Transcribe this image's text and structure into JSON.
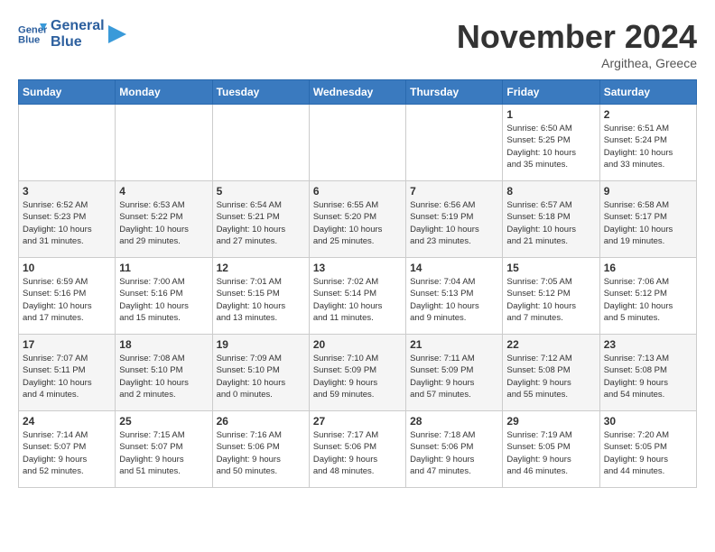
{
  "logo": {
    "line1": "General",
    "line2": "Blue"
  },
  "header": {
    "month": "November 2024",
    "location": "Argithea, Greece"
  },
  "weekdays": [
    "Sunday",
    "Monday",
    "Tuesday",
    "Wednesday",
    "Thursday",
    "Friday",
    "Saturday"
  ],
  "weeks": [
    [
      {
        "day": "",
        "info": ""
      },
      {
        "day": "",
        "info": ""
      },
      {
        "day": "",
        "info": ""
      },
      {
        "day": "",
        "info": ""
      },
      {
        "day": "",
        "info": ""
      },
      {
        "day": "1",
        "info": "Sunrise: 6:50 AM\nSunset: 5:25 PM\nDaylight: 10 hours\nand 35 minutes."
      },
      {
        "day": "2",
        "info": "Sunrise: 6:51 AM\nSunset: 5:24 PM\nDaylight: 10 hours\nand 33 minutes."
      }
    ],
    [
      {
        "day": "3",
        "info": "Sunrise: 6:52 AM\nSunset: 5:23 PM\nDaylight: 10 hours\nand 31 minutes."
      },
      {
        "day": "4",
        "info": "Sunrise: 6:53 AM\nSunset: 5:22 PM\nDaylight: 10 hours\nand 29 minutes."
      },
      {
        "day": "5",
        "info": "Sunrise: 6:54 AM\nSunset: 5:21 PM\nDaylight: 10 hours\nand 27 minutes."
      },
      {
        "day": "6",
        "info": "Sunrise: 6:55 AM\nSunset: 5:20 PM\nDaylight: 10 hours\nand 25 minutes."
      },
      {
        "day": "7",
        "info": "Sunrise: 6:56 AM\nSunset: 5:19 PM\nDaylight: 10 hours\nand 23 minutes."
      },
      {
        "day": "8",
        "info": "Sunrise: 6:57 AM\nSunset: 5:18 PM\nDaylight: 10 hours\nand 21 minutes."
      },
      {
        "day": "9",
        "info": "Sunrise: 6:58 AM\nSunset: 5:17 PM\nDaylight: 10 hours\nand 19 minutes."
      }
    ],
    [
      {
        "day": "10",
        "info": "Sunrise: 6:59 AM\nSunset: 5:16 PM\nDaylight: 10 hours\nand 17 minutes."
      },
      {
        "day": "11",
        "info": "Sunrise: 7:00 AM\nSunset: 5:16 PM\nDaylight: 10 hours\nand 15 minutes."
      },
      {
        "day": "12",
        "info": "Sunrise: 7:01 AM\nSunset: 5:15 PM\nDaylight: 10 hours\nand 13 minutes."
      },
      {
        "day": "13",
        "info": "Sunrise: 7:02 AM\nSunset: 5:14 PM\nDaylight: 10 hours\nand 11 minutes."
      },
      {
        "day": "14",
        "info": "Sunrise: 7:04 AM\nSunset: 5:13 PM\nDaylight: 10 hours\nand 9 minutes."
      },
      {
        "day": "15",
        "info": "Sunrise: 7:05 AM\nSunset: 5:12 PM\nDaylight: 10 hours\nand 7 minutes."
      },
      {
        "day": "16",
        "info": "Sunrise: 7:06 AM\nSunset: 5:12 PM\nDaylight: 10 hours\nand 5 minutes."
      }
    ],
    [
      {
        "day": "17",
        "info": "Sunrise: 7:07 AM\nSunset: 5:11 PM\nDaylight: 10 hours\nand 4 minutes."
      },
      {
        "day": "18",
        "info": "Sunrise: 7:08 AM\nSunset: 5:10 PM\nDaylight: 10 hours\nand 2 minutes."
      },
      {
        "day": "19",
        "info": "Sunrise: 7:09 AM\nSunset: 5:10 PM\nDaylight: 10 hours\nand 0 minutes."
      },
      {
        "day": "20",
        "info": "Sunrise: 7:10 AM\nSunset: 5:09 PM\nDaylight: 9 hours\nand 59 minutes."
      },
      {
        "day": "21",
        "info": "Sunrise: 7:11 AM\nSunset: 5:09 PM\nDaylight: 9 hours\nand 57 minutes."
      },
      {
        "day": "22",
        "info": "Sunrise: 7:12 AM\nSunset: 5:08 PM\nDaylight: 9 hours\nand 55 minutes."
      },
      {
        "day": "23",
        "info": "Sunrise: 7:13 AM\nSunset: 5:08 PM\nDaylight: 9 hours\nand 54 minutes."
      }
    ],
    [
      {
        "day": "24",
        "info": "Sunrise: 7:14 AM\nSunset: 5:07 PM\nDaylight: 9 hours\nand 52 minutes."
      },
      {
        "day": "25",
        "info": "Sunrise: 7:15 AM\nSunset: 5:07 PM\nDaylight: 9 hours\nand 51 minutes."
      },
      {
        "day": "26",
        "info": "Sunrise: 7:16 AM\nSunset: 5:06 PM\nDaylight: 9 hours\nand 50 minutes."
      },
      {
        "day": "27",
        "info": "Sunrise: 7:17 AM\nSunset: 5:06 PM\nDaylight: 9 hours\nand 48 minutes."
      },
      {
        "day": "28",
        "info": "Sunrise: 7:18 AM\nSunset: 5:06 PM\nDaylight: 9 hours\nand 47 minutes."
      },
      {
        "day": "29",
        "info": "Sunrise: 7:19 AM\nSunset: 5:05 PM\nDaylight: 9 hours\nand 46 minutes."
      },
      {
        "day": "30",
        "info": "Sunrise: 7:20 AM\nSunset: 5:05 PM\nDaylight: 9 hours\nand 44 minutes."
      }
    ]
  ]
}
